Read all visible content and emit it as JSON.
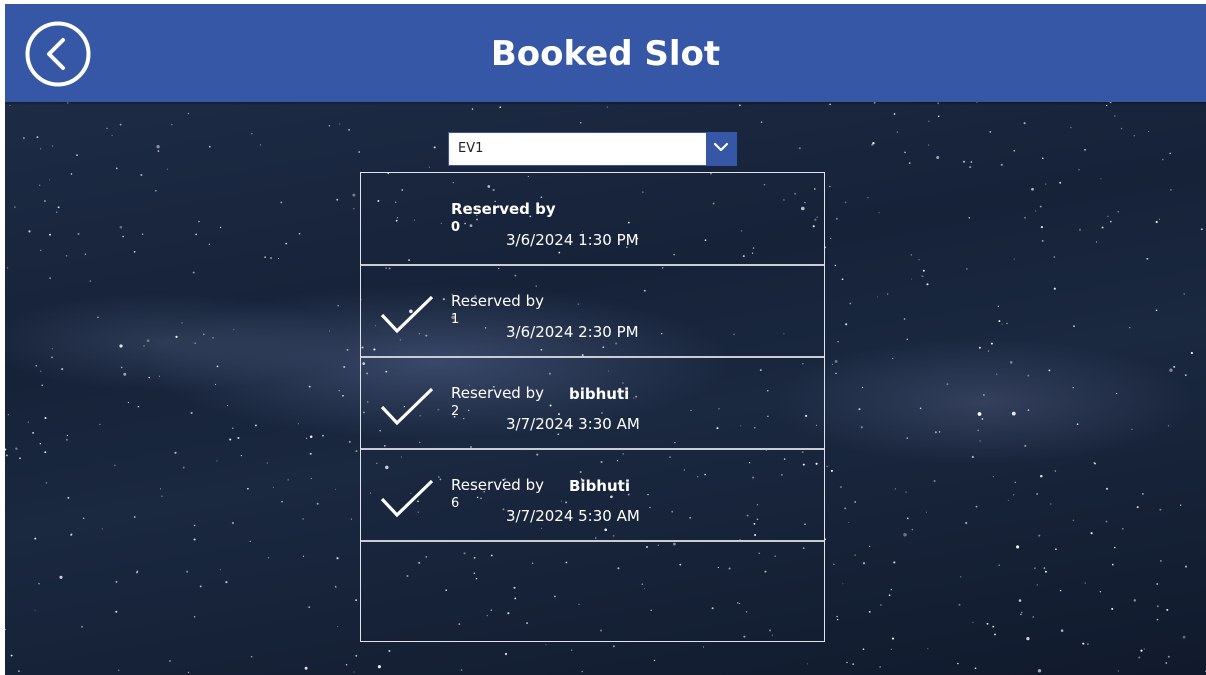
{
  "header": {
    "title": "Booked Slot",
    "back_icon": "back-arrow-circle-icon",
    "background": "#3557a5"
  },
  "station_select": {
    "value": "EV1",
    "chevron_icon": "chevron-down-icon"
  },
  "slots": [
    {
      "reserved_label": "Reserved by",
      "user": "",
      "slot": "0",
      "time": "3/6/2024 1:30 PM",
      "booked": false
    },
    {
      "reserved_label": "Reserved by",
      "user": "",
      "slot": "1",
      "time": "3/6/2024 2:30 PM",
      "booked": true
    },
    {
      "reserved_label": "Reserved by",
      "user": "bibhuti",
      "slot": "2",
      "time": "3/7/2024 3:30 AM",
      "booked": true
    },
    {
      "reserved_label": "Reserved by",
      "user": "Bibhuti",
      "slot": "6",
      "time": "3/7/2024 5:30 AM",
      "booked": true
    }
  ],
  "colors": {
    "accent": "#3557a5",
    "text": "#ffffff",
    "separator": "#c9ccd3"
  }
}
